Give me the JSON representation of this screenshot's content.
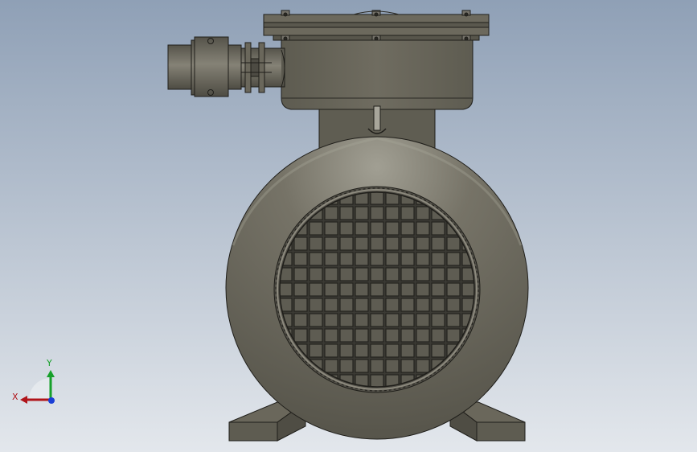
{
  "viewport": {
    "background_top": "#8fa0b6",
    "background_bottom": "#e3e7ec",
    "model_body_color": "#6e6b5f",
    "model_highlight_color": "#9b998d",
    "edge_color": "#1f1e1a"
  },
  "triad": {
    "x_label": "X",
    "y_label": "Y",
    "x_color": "#b0141a",
    "y_color": "#16a02a",
    "z_color": "#1a3fd6"
  }
}
